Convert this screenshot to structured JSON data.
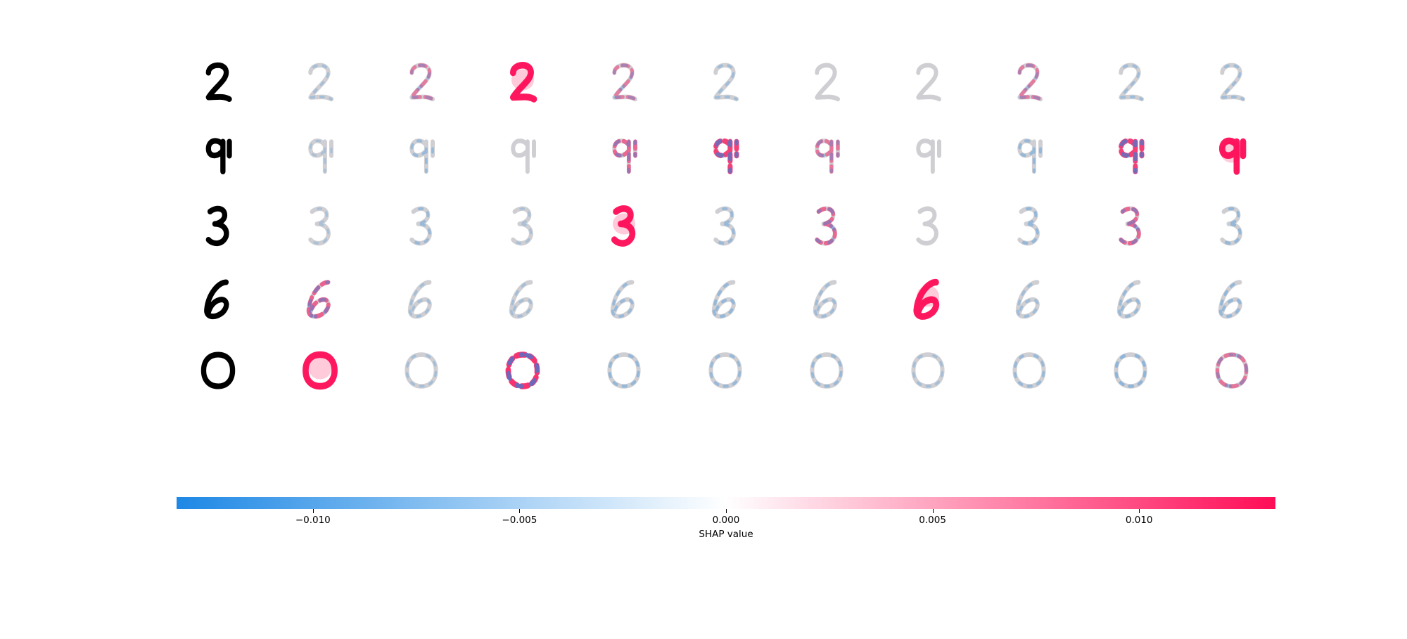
{
  "chart_data": {
    "type": "heatmap",
    "subtype": "shap_image_plot",
    "rows": [
      {
        "input_digit": "2",
        "shap_by_output": [
          {
            "class": 0,
            "strength": 0.15,
            "sign": "neg"
          },
          {
            "class": 1,
            "strength": 0.25,
            "sign": "mixed"
          },
          {
            "class": 2,
            "strength": 1.0,
            "sign": "pos"
          },
          {
            "class": 3,
            "strength": 0.25,
            "sign": "mixed"
          },
          {
            "class": 4,
            "strength": 0.2,
            "sign": "neg"
          },
          {
            "class": 5,
            "strength": 0.0,
            "sign": "none"
          },
          {
            "class": 6,
            "strength": 0.05,
            "sign": "none"
          },
          {
            "class": 7,
            "strength": 0.25,
            "sign": "mixed"
          },
          {
            "class": 8,
            "strength": 0.2,
            "sign": "neg"
          },
          {
            "class": 9,
            "strength": 0.2,
            "sign": "neg"
          }
        ]
      },
      {
        "input_digit": "9",
        "shap_by_output": [
          {
            "class": 0,
            "strength": 0.1,
            "sign": "neg"
          },
          {
            "class": 1,
            "strength": 0.25,
            "sign": "neg"
          },
          {
            "class": 2,
            "strength": 0.05,
            "sign": "none"
          },
          {
            "class": 3,
            "strength": 0.4,
            "sign": "mixed"
          },
          {
            "class": 4,
            "strength": 0.7,
            "sign": "mixed"
          },
          {
            "class": 5,
            "strength": 0.3,
            "sign": "mixed"
          },
          {
            "class": 6,
            "strength": 0.05,
            "sign": "none"
          },
          {
            "class": 7,
            "strength": 0.3,
            "sign": "neg"
          },
          {
            "class": 8,
            "strength": 0.7,
            "sign": "mixed"
          },
          {
            "class": 9,
            "strength": 1.0,
            "sign": "pos"
          }
        ]
      },
      {
        "input_digit": "3",
        "shap_by_output": [
          {
            "class": 0,
            "strength": 0.1,
            "sign": "neg"
          },
          {
            "class": 1,
            "strength": 0.25,
            "sign": "neg"
          },
          {
            "class": 2,
            "strength": 0.1,
            "sign": "neg"
          },
          {
            "class": 3,
            "strength": 1.0,
            "sign": "pos"
          },
          {
            "class": 4,
            "strength": 0.25,
            "sign": "neg"
          },
          {
            "class": 5,
            "strength": 0.4,
            "sign": "mixed"
          },
          {
            "class": 6,
            "strength": 0.05,
            "sign": "none"
          },
          {
            "class": 7,
            "strength": 0.3,
            "sign": "neg"
          },
          {
            "class": 8,
            "strength": 0.4,
            "sign": "mixed"
          },
          {
            "class": 9,
            "strength": 0.3,
            "sign": "neg"
          }
        ]
      },
      {
        "input_digit": "6",
        "shap_by_output": [
          {
            "class": 0,
            "strength": 0.45,
            "sign": "mixed"
          },
          {
            "class": 1,
            "strength": 0.15,
            "sign": "neg"
          },
          {
            "class": 2,
            "strength": 0.15,
            "sign": "neg"
          },
          {
            "class": 3,
            "strength": 0.25,
            "sign": "neg"
          },
          {
            "class": 4,
            "strength": 0.3,
            "sign": "neg"
          },
          {
            "class": 5,
            "strength": 0.2,
            "sign": "neg"
          },
          {
            "class": 6,
            "strength": 1.0,
            "sign": "pos"
          },
          {
            "class": 7,
            "strength": 0.2,
            "sign": "neg"
          },
          {
            "class": 8,
            "strength": 0.25,
            "sign": "neg"
          },
          {
            "class": 9,
            "strength": 0.3,
            "sign": "neg"
          }
        ]
      },
      {
        "input_digit": "0",
        "shap_by_output": [
          {
            "class": 0,
            "strength": 1.0,
            "sign": "pos"
          },
          {
            "class": 1,
            "strength": 0.15,
            "sign": "neg"
          },
          {
            "class": 2,
            "strength": 0.8,
            "sign": "mixed"
          },
          {
            "class": 3,
            "strength": 0.3,
            "sign": "neg"
          },
          {
            "class": 4,
            "strength": 0.25,
            "sign": "neg"
          },
          {
            "class": 5,
            "strength": 0.25,
            "sign": "neg"
          },
          {
            "class": 6,
            "strength": 0.15,
            "sign": "neg"
          },
          {
            "class": 7,
            "strength": 0.25,
            "sign": "neg"
          },
          {
            "class": 8,
            "strength": 0.35,
            "sign": "neg"
          },
          {
            "class": 9,
            "strength": 0.3,
            "sign": "mixed"
          }
        ]
      }
    ],
    "colorbar": {
      "label": "SHAP value",
      "range": [
        -0.0133,
        0.0133
      ],
      "ticks": [
        -0.01,
        -0.005,
        0.0,
        0.005,
        0.01
      ],
      "tick_labels": [
        "−0.010",
        "−0.005",
        "0.000",
        "0.005",
        "0.010"
      ],
      "colors": {
        "negative": "#1e88e5",
        "zero": "#ffffff",
        "positive": "#ff0d57"
      }
    },
    "colors": {
      "input_ink": "#000000",
      "ghost_ink": "#cfcfd3"
    }
  }
}
